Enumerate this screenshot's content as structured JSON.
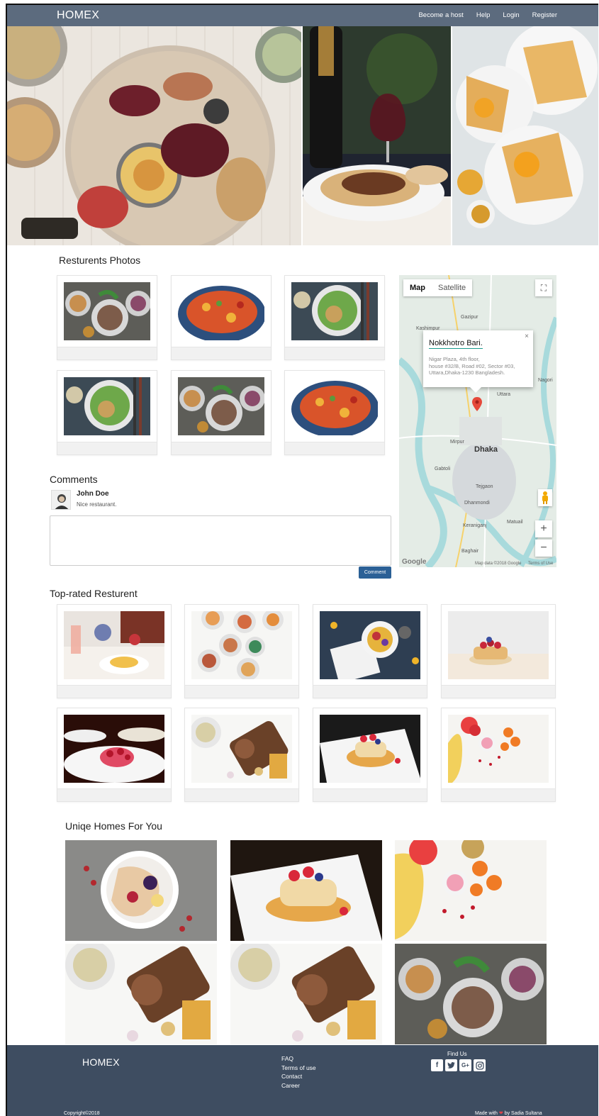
{
  "nav": {
    "brand": "HOMEX",
    "links": [
      "Become a host",
      "Help",
      "Login",
      "Register"
    ]
  },
  "sections": {
    "restaurant_photos": "Resturents Photos",
    "comments": "Comments",
    "top_rated": "Top-rated Resturent",
    "unique_homes": "Uniqe Homes For You"
  },
  "map": {
    "tab_map": "Map",
    "tab_satellite": "Satellite",
    "info_title": "Nokkhotro Bari.",
    "info_address": "Nigar Plaza, 4th floor,\nhouse #32/B, Road #02, Sector #03,\nUttara,Dhaka-1230 Bangladesh.",
    "city_label": "Dhaka",
    "place_labels": [
      "Gazipur",
      "Kashimpur",
      "Uttara",
      "Nagori",
      "Mirpur",
      "Gabtoli",
      "Tejgaon",
      "Dhanmondi",
      "Keraniganj",
      "Baghair",
      "Matuail"
    ],
    "map_data_text": "Map data ©2018 Google",
    "terms_text": "Terms of Use",
    "google_text": "Google"
  },
  "comment": {
    "name": "John Doe",
    "text": "Nice restaurant.",
    "button": "Comment"
  },
  "footer": {
    "brand": "HOMEX",
    "links": [
      "FAQ",
      "Terms of use",
      "Contact",
      "Career"
    ],
    "find_us": "Find Us",
    "copyright": "Copyright©2018",
    "made_prefix": "Made with",
    "made_suffix": "by Sadia Sultana"
  },
  "colors": {
    "navbar": "#5c6b7e",
    "footer": "#3e4d61",
    "button": "#2b6096"
  }
}
